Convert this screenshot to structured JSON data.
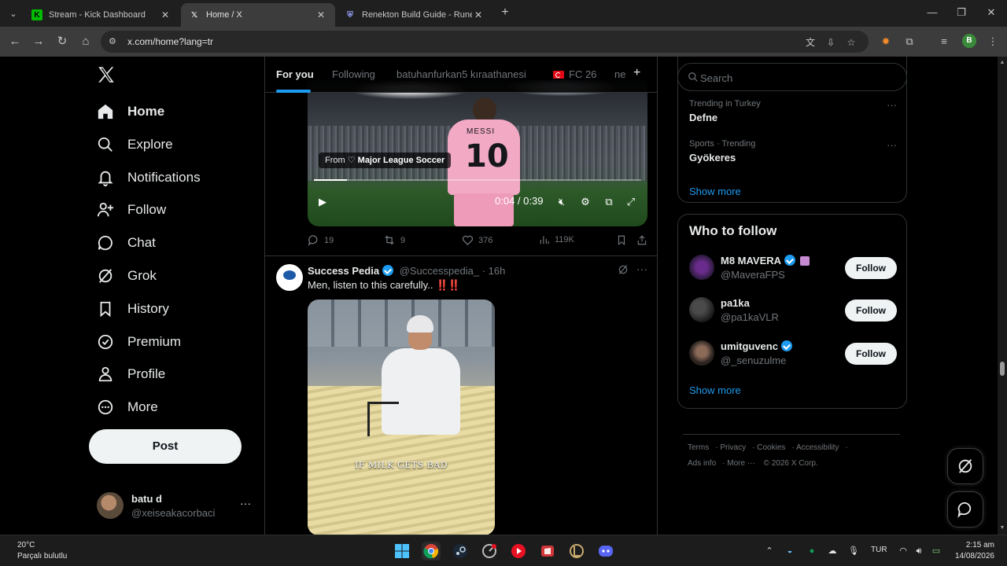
{
  "browser": {
    "tabs": [
      {
        "title": "Stream - Kick Dashboard",
        "favicon": "kick-icon",
        "active": false
      },
      {
        "title": "Home / X",
        "favicon": "x-icon",
        "active": true
      },
      {
        "title": "Renekton Build Guide - Runes, I",
        "favicon": "league-icon",
        "active": false
      }
    ],
    "url": "x.com/home?lang=tr",
    "profile_initial": "B"
  },
  "x": {
    "nav": [
      {
        "label": "Home",
        "icon": "home-icon"
      },
      {
        "label": "Explore",
        "icon": "search-icon"
      },
      {
        "label": "Notifications",
        "icon": "bell-icon"
      },
      {
        "label": "Follow",
        "icon": "person-plus-icon"
      },
      {
        "label": "Chat",
        "icon": "chat-icon"
      },
      {
        "label": "Grok",
        "icon": "grok-icon"
      },
      {
        "label": "History",
        "icon": "bookmark-icon"
      },
      {
        "label": "Premium",
        "icon": "verified-icon"
      },
      {
        "label": "Profile",
        "icon": "person-icon"
      },
      {
        "label": "More",
        "icon": "more-circle-icon"
      }
    ],
    "post_label": "Post",
    "me": {
      "name": "batu d",
      "handle": "@xeiseakacorbaci"
    },
    "timeline_tabs": [
      "For you",
      "Following",
      "batuhanfurkan5 kıraathanesi",
      "FC 26",
      "ne"
    ],
    "tweet1": {
      "video_from": "From",
      "video_source": "Major League Soccer",
      "jersey_name": "MESSI",
      "jersey_number": "10",
      "time": "0:04 / 0:39",
      "progress": 0.1,
      "replies": "19",
      "retweets": "9",
      "likes": "376",
      "views": "119K"
    },
    "tweet2": {
      "name": "Success Pedia",
      "handle": "@Successpedia_",
      "age": "16h",
      "text": "Men, listen to this carefully..",
      "emphasis": "‼️‼️",
      "caption": "IF MILK GETS BAD"
    },
    "search": {
      "placeholder": "Search"
    },
    "trends": [
      {
        "meta": "Trending in Turkey",
        "title": "Defne"
      },
      {
        "meta": "Sports · Trending",
        "title": "Gyökeres"
      }
    ],
    "trends_show_more": "Show more",
    "who_to_follow": {
      "title": "Who to follow",
      "users": [
        {
          "name": "M8 MAVERA",
          "handle": "@MaveraFPS",
          "button": "Follow"
        },
        {
          "name": "pa1ka",
          "handle": "@pa1kaVLR",
          "button": "Follow"
        },
        {
          "name": "umitguvenc",
          "handle": "@_senuzulme",
          "button": "Follow"
        }
      ],
      "show_more": "Show more"
    },
    "footer": [
      "Terms",
      "Privacy",
      "Cookies",
      "Accessibility",
      "Ads info",
      "More ···",
      "© 2026 X Corp."
    ]
  },
  "taskbar": {
    "temp": "20°C",
    "weather": "Parçalı bulutlu",
    "lang": "TUR",
    "time": "2:15 am",
    "date": "14/08/2026"
  },
  "colors": {
    "accent": "#1d9bf0",
    "border": "#2f3336",
    "muted": "#71767b"
  }
}
